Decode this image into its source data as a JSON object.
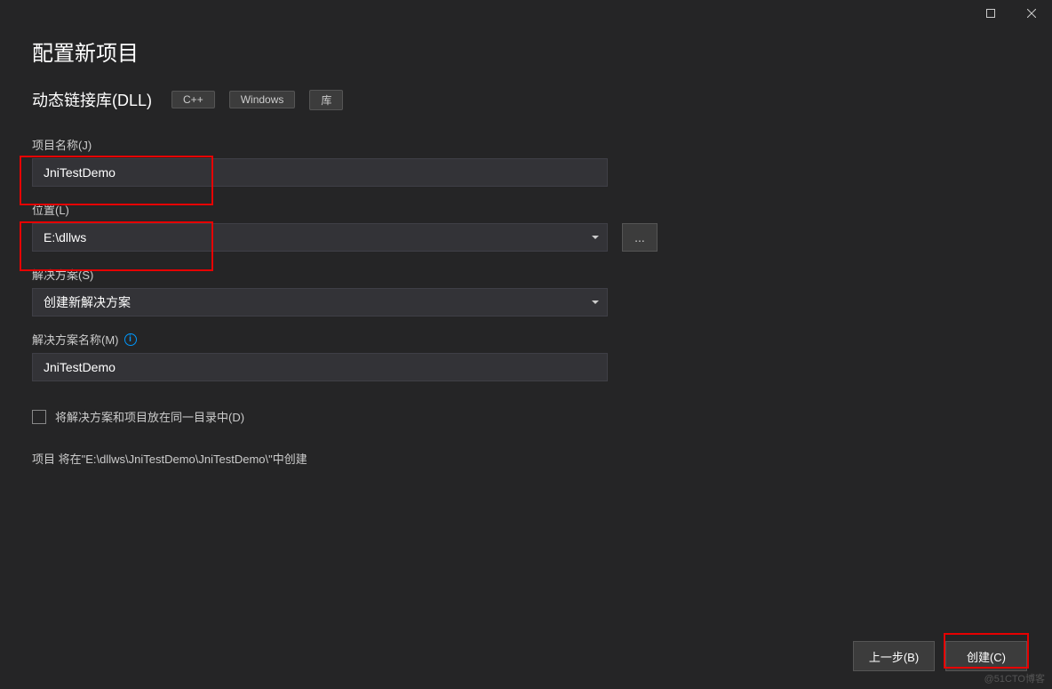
{
  "titlebar": {
    "maximize_icon": "maximize",
    "close_icon": "close"
  },
  "page": {
    "title": "配置新项目",
    "subtitle": "动态链接库(DLL)",
    "tags": [
      "C++",
      "Windows",
      "库"
    ]
  },
  "form": {
    "project_name": {
      "label": "项目名称(J)",
      "value": "JniTestDemo"
    },
    "location": {
      "label": "位置(L)",
      "value": "E:\\dllws",
      "browse_label": "..."
    },
    "solution": {
      "label": "解决方案(S)",
      "value": "创建新解决方案"
    },
    "solution_name": {
      "label": "解决方案名称(M)",
      "value": "JniTestDemo"
    },
    "same_dir_checkbox": {
      "label": "将解决方案和项目放在同一目录中(D)",
      "checked": false
    },
    "path_info": "项目 将在\"E:\\dllws\\JniTestDemo\\JniTestDemo\\\"中创建"
  },
  "footer": {
    "back_label": "上一步(B)",
    "create_label": "创建(C)"
  },
  "watermark": "@51CTO博客"
}
